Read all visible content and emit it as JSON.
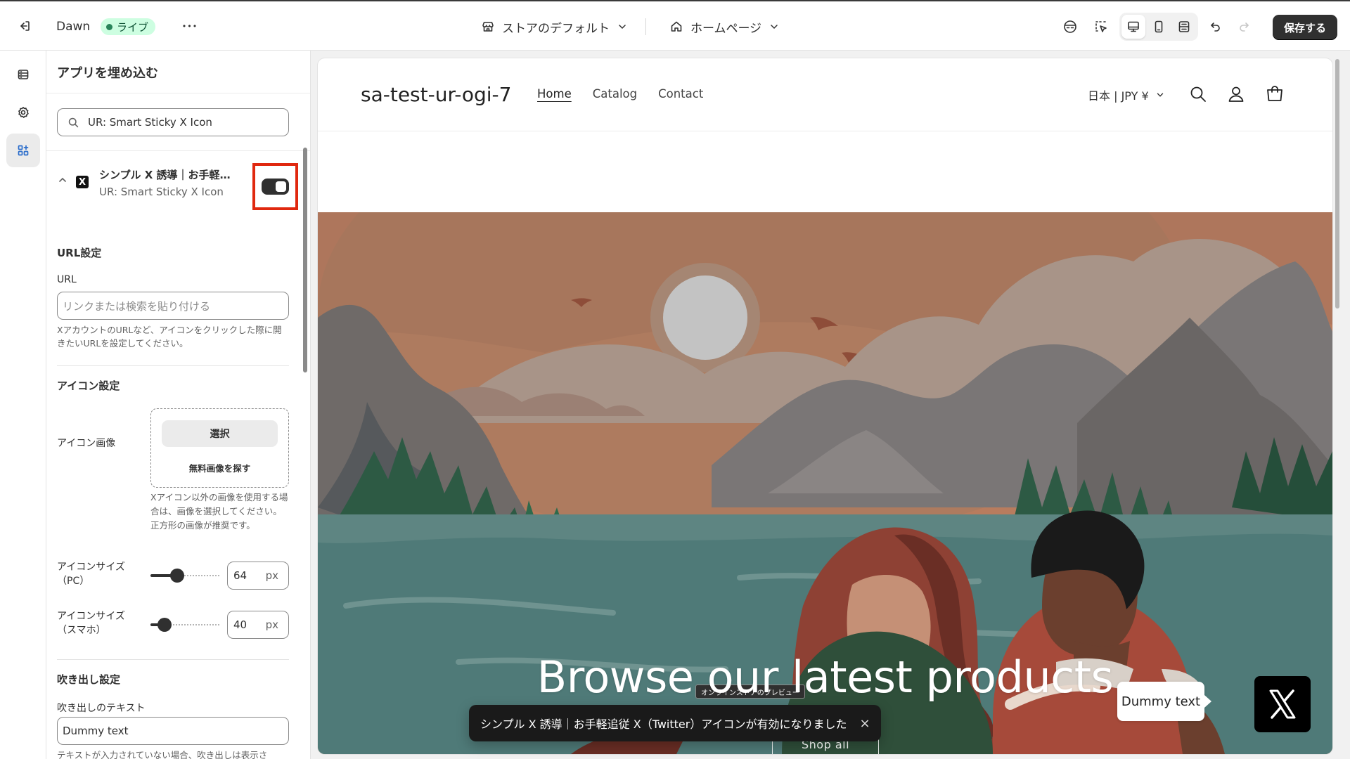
{
  "topbar": {
    "theme_name": "Dawn",
    "live_badge": "ライブ",
    "more": "•••",
    "store_selector": "ストアのデフォルト",
    "page_selector": "ホームページ",
    "save_label": "保存する"
  },
  "sidebar": {
    "title": "アプリを埋め込む",
    "search_value": "UR: Smart Sticky X Icon",
    "app": {
      "name": "シンプル X 誘導｜お手軽追従 X（Twitter）アイコン",
      "subtitle": "UR: Smart Sticky X Icon",
      "icon_letter": "X",
      "enabled": true
    },
    "url_section": {
      "heading": "URL設定",
      "label": "URL",
      "placeholder": "リンクまたは検索を貼り付ける",
      "help": "XアカウントのURLなど、アイコンをクリックした際に開きたいURLを設定してください。"
    },
    "icon_section": {
      "heading": "アイコン設定",
      "image_label": "アイコン画像",
      "select_button": "選択",
      "free_images_link": "無料画像を探す",
      "image_help": "Xアイコン以外の画像を使用する場合は、画像を選択してください。正方形の画像が推奨です。",
      "size_pc_label_1": "アイコンサイズ",
      "size_pc_label_2": "（PC）",
      "size_pc_value": "64",
      "size_pc_fraction": 0.35,
      "size_sp_label_1": "アイコンサイズ",
      "size_sp_label_2": "（スマホ）",
      "size_sp_value": "40",
      "size_sp_fraction": 0.12,
      "unit": "px"
    },
    "bubble_section": {
      "heading": "吹き出し設定",
      "text_label": "吹き出しのテキスト",
      "text_value": "Dummy text",
      "help_cut": "テキストが入力されていない場合、吹き出しは表示さ"
    }
  },
  "preview": {
    "store_name": "sa-test-ur-ogi-7",
    "nav": [
      "Home",
      "Catalog",
      "Contact"
    ],
    "currency": "日本 | JPY ¥",
    "hero_title": "Browse our latest products",
    "hero_button": "Shop all",
    "preview_badge": "オンラインストアのプレビュー",
    "bubble_text": "Dummy text",
    "colors": {
      "sky": "#b87c5e",
      "sun": "#bdbdbd",
      "water": "#4f7a78",
      "trees": "#2d5a44"
    }
  },
  "toast": {
    "message": "シンプル X 誘導｜お手軽追従 X（Twitter）アイコンが有効になりました",
    "close": "×"
  }
}
